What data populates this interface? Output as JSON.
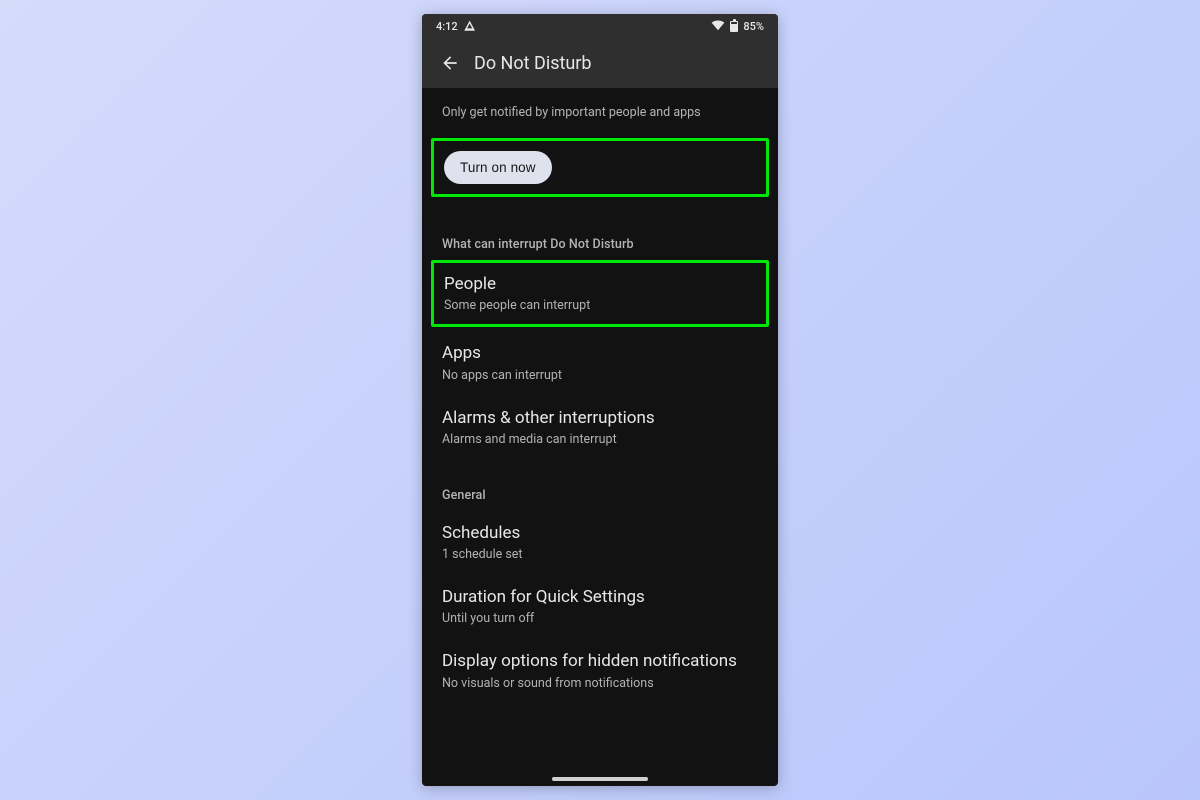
{
  "status": {
    "time": "4:12",
    "battery_pct": "85%"
  },
  "appbar": {
    "title": "Do Not Disturb"
  },
  "description": "Only get notified by important people and apps",
  "toggle_button_label": "Turn on now",
  "sections": {
    "interrupt_header": "What can interrupt Do Not Disturb",
    "general_header": "General"
  },
  "items": {
    "people": {
      "title": "People",
      "sub": "Some people can interrupt"
    },
    "apps": {
      "title": "Apps",
      "sub": "No apps can interrupt"
    },
    "alarms": {
      "title": "Alarms & other interruptions",
      "sub": "Alarms and media can interrupt"
    },
    "schedules": {
      "title": "Schedules",
      "sub": "1 schedule set"
    },
    "duration": {
      "title": "Duration for Quick Settings",
      "sub": "Until you turn off"
    },
    "display": {
      "title": "Display options for hidden notifications",
      "sub": "No visuals or sound from notifications"
    }
  },
  "highlight_color": "#00e80a"
}
